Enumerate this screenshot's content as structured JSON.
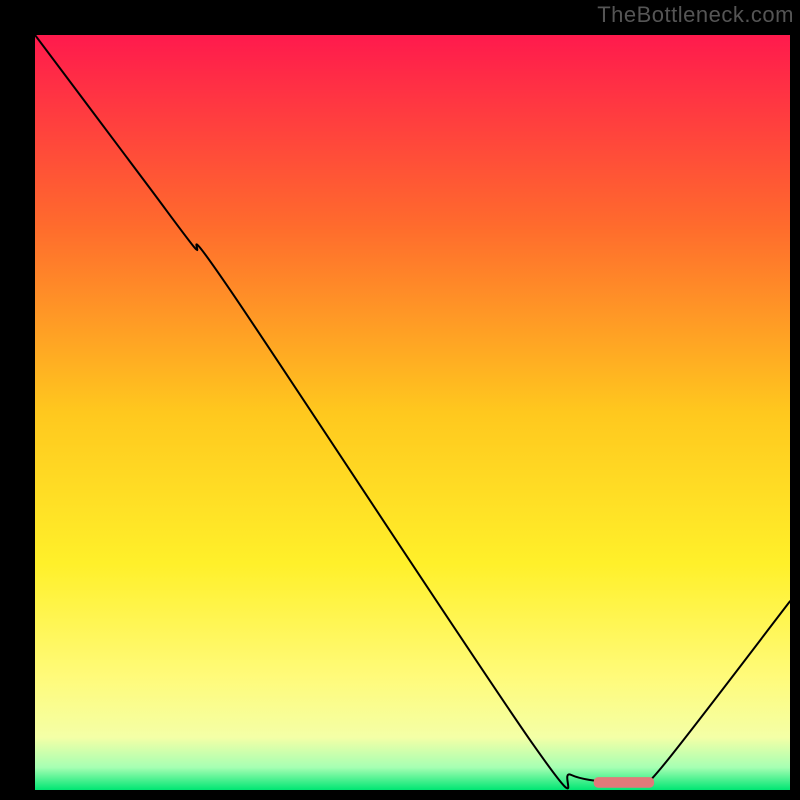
{
  "watermark": "TheBottleneck.com",
  "chart_data": {
    "type": "line",
    "title": "",
    "xlabel": "",
    "ylabel": "",
    "xlim": [
      0,
      100
    ],
    "ylim": [
      0,
      100
    ],
    "grid": false,
    "background": {
      "type": "vertical-gradient",
      "stops": [
        {
          "offset": 0.0,
          "color": "#ff1a4d"
        },
        {
          "offset": 0.25,
          "color": "#ff6a2d"
        },
        {
          "offset": 0.5,
          "color": "#ffc81e"
        },
        {
          "offset": 0.7,
          "color": "#fff02a"
        },
        {
          "offset": 0.85,
          "color": "#fffb7a"
        },
        {
          "offset": 0.93,
          "color": "#f4ffa6"
        },
        {
          "offset": 0.97,
          "color": "#a6ffb3"
        },
        {
          "offset": 1.0,
          "color": "#00e673"
        }
      ]
    },
    "series": [
      {
        "name": "curve",
        "x": [
          0.0,
          6.0,
          15.0,
          21.0,
          26.0,
          66.0,
          71.0,
          77.0,
          80.0,
          83.0,
          100.0
        ],
        "y": [
          100.0,
          92.0,
          80.0,
          72.0,
          66.0,
          6.0,
          2.0,
          1.0,
          1.0,
          3.0,
          25.0
        ]
      }
    ],
    "marker": {
      "name": "highlight-segment",
      "x_start": 74.0,
      "x_end": 82.0,
      "y": 1.0,
      "color": "#e07a7a"
    }
  }
}
